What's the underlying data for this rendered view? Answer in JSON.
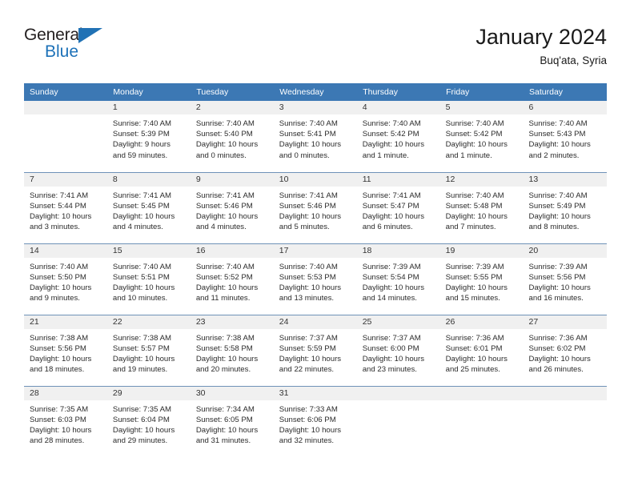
{
  "brand": {
    "name_part1": "General",
    "name_part2": "Blue",
    "accent_color": "#2172b5",
    "triangle_icon": "triangle-icon"
  },
  "header": {
    "title": "January 2024",
    "subtitle": "Buq'ata, Syria",
    "header_bg_color": "#3c78b4"
  },
  "calendar": {
    "weekday_headers": [
      "Sunday",
      "Monday",
      "Tuesday",
      "Wednesday",
      "Thursday",
      "Friday",
      "Saturday"
    ],
    "weeks": [
      [
        {
          "day": "",
          "sunrise": "",
          "sunset": "",
          "daylight_line1": "",
          "daylight_line2": ""
        },
        {
          "day": "1",
          "sunrise": "Sunrise: 7:40 AM",
          "sunset": "Sunset: 5:39 PM",
          "daylight_line1": "Daylight: 9 hours",
          "daylight_line2": "and 59 minutes."
        },
        {
          "day": "2",
          "sunrise": "Sunrise: 7:40 AM",
          "sunset": "Sunset: 5:40 PM",
          "daylight_line1": "Daylight: 10 hours",
          "daylight_line2": "and 0 minutes."
        },
        {
          "day": "3",
          "sunrise": "Sunrise: 7:40 AM",
          "sunset": "Sunset: 5:41 PM",
          "daylight_line1": "Daylight: 10 hours",
          "daylight_line2": "and 0 minutes."
        },
        {
          "day": "4",
          "sunrise": "Sunrise: 7:40 AM",
          "sunset": "Sunset: 5:42 PM",
          "daylight_line1": "Daylight: 10 hours",
          "daylight_line2": "and 1 minute."
        },
        {
          "day": "5",
          "sunrise": "Sunrise: 7:40 AM",
          "sunset": "Sunset: 5:42 PM",
          "daylight_line1": "Daylight: 10 hours",
          "daylight_line2": "and 1 minute."
        },
        {
          "day": "6",
          "sunrise": "Sunrise: 7:40 AM",
          "sunset": "Sunset: 5:43 PM",
          "daylight_line1": "Daylight: 10 hours",
          "daylight_line2": "and 2 minutes."
        }
      ],
      [
        {
          "day": "7",
          "sunrise": "Sunrise: 7:41 AM",
          "sunset": "Sunset: 5:44 PM",
          "daylight_line1": "Daylight: 10 hours",
          "daylight_line2": "and 3 minutes."
        },
        {
          "day": "8",
          "sunrise": "Sunrise: 7:41 AM",
          "sunset": "Sunset: 5:45 PM",
          "daylight_line1": "Daylight: 10 hours",
          "daylight_line2": "and 4 minutes."
        },
        {
          "day": "9",
          "sunrise": "Sunrise: 7:41 AM",
          "sunset": "Sunset: 5:46 PM",
          "daylight_line1": "Daylight: 10 hours",
          "daylight_line2": "and 4 minutes."
        },
        {
          "day": "10",
          "sunrise": "Sunrise: 7:41 AM",
          "sunset": "Sunset: 5:46 PM",
          "daylight_line1": "Daylight: 10 hours",
          "daylight_line2": "and 5 minutes."
        },
        {
          "day": "11",
          "sunrise": "Sunrise: 7:41 AM",
          "sunset": "Sunset: 5:47 PM",
          "daylight_line1": "Daylight: 10 hours",
          "daylight_line2": "and 6 minutes."
        },
        {
          "day": "12",
          "sunrise": "Sunrise: 7:40 AM",
          "sunset": "Sunset: 5:48 PM",
          "daylight_line1": "Daylight: 10 hours",
          "daylight_line2": "and 7 minutes."
        },
        {
          "day": "13",
          "sunrise": "Sunrise: 7:40 AM",
          "sunset": "Sunset: 5:49 PM",
          "daylight_line1": "Daylight: 10 hours",
          "daylight_line2": "and 8 minutes."
        }
      ],
      [
        {
          "day": "14",
          "sunrise": "Sunrise: 7:40 AM",
          "sunset": "Sunset: 5:50 PM",
          "daylight_line1": "Daylight: 10 hours",
          "daylight_line2": "and 9 minutes."
        },
        {
          "day": "15",
          "sunrise": "Sunrise: 7:40 AM",
          "sunset": "Sunset: 5:51 PM",
          "daylight_line1": "Daylight: 10 hours",
          "daylight_line2": "and 10 minutes."
        },
        {
          "day": "16",
          "sunrise": "Sunrise: 7:40 AM",
          "sunset": "Sunset: 5:52 PM",
          "daylight_line1": "Daylight: 10 hours",
          "daylight_line2": "and 11 minutes."
        },
        {
          "day": "17",
          "sunrise": "Sunrise: 7:40 AM",
          "sunset": "Sunset: 5:53 PM",
          "daylight_line1": "Daylight: 10 hours",
          "daylight_line2": "and 13 minutes."
        },
        {
          "day": "18",
          "sunrise": "Sunrise: 7:39 AM",
          "sunset": "Sunset: 5:54 PM",
          "daylight_line1": "Daylight: 10 hours",
          "daylight_line2": "and 14 minutes."
        },
        {
          "day": "19",
          "sunrise": "Sunrise: 7:39 AM",
          "sunset": "Sunset: 5:55 PM",
          "daylight_line1": "Daylight: 10 hours",
          "daylight_line2": "and 15 minutes."
        },
        {
          "day": "20",
          "sunrise": "Sunrise: 7:39 AM",
          "sunset": "Sunset: 5:56 PM",
          "daylight_line1": "Daylight: 10 hours",
          "daylight_line2": "and 16 minutes."
        }
      ],
      [
        {
          "day": "21",
          "sunrise": "Sunrise: 7:38 AM",
          "sunset": "Sunset: 5:56 PM",
          "daylight_line1": "Daylight: 10 hours",
          "daylight_line2": "and 18 minutes."
        },
        {
          "day": "22",
          "sunrise": "Sunrise: 7:38 AM",
          "sunset": "Sunset: 5:57 PM",
          "daylight_line1": "Daylight: 10 hours",
          "daylight_line2": "and 19 minutes."
        },
        {
          "day": "23",
          "sunrise": "Sunrise: 7:38 AM",
          "sunset": "Sunset: 5:58 PM",
          "daylight_line1": "Daylight: 10 hours",
          "daylight_line2": "and 20 minutes."
        },
        {
          "day": "24",
          "sunrise": "Sunrise: 7:37 AM",
          "sunset": "Sunset: 5:59 PM",
          "daylight_line1": "Daylight: 10 hours",
          "daylight_line2": "and 22 minutes."
        },
        {
          "day": "25",
          "sunrise": "Sunrise: 7:37 AM",
          "sunset": "Sunset: 6:00 PM",
          "daylight_line1": "Daylight: 10 hours",
          "daylight_line2": "and 23 minutes."
        },
        {
          "day": "26",
          "sunrise": "Sunrise: 7:36 AM",
          "sunset": "Sunset: 6:01 PM",
          "daylight_line1": "Daylight: 10 hours",
          "daylight_line2": "and 25 minutes."
        },
        {
          "day": "27",
          "sunrise": "Sunrise: 7:36 AM",
          "sunset": "Sunset: 6:02 PM",
          "daylight_line1": "Daylight: 10 hours",
          "daylight_line2": "and 26 minutes."
        }
      ],
      [
        {
          "day": "28",
          "sunrise": "Sunrise: 7:35 AM",
          "sunset": "Sunset: 6:03 PM",
          "daylight_line1": "Daylight: 10 hours",
          "daylight_line2": "and 28 minutes."
        },
        {
          "day": "29",
          "sunrise": "Sunrise: 7:35 AM",
          "sunset": "Sunset: 6:04 PM",
          "daylight_line1": "Daylight: 10 hours",
          "daylight_line2": "and 29 minutes."
        },
        {
          "day": "30",
          "sunrise": "Sunrise: 7:34 AM",
          "sunset": "Sunset: 6:05 PM",
          "daylight_line1": "Daylight: 10 hours",
          "daylight_line2": "and 31 minutes."
        },
        {
          "day": "31",
          "sunrise": "Sunrise: 7:33 AM",
          "sunset": "Sunset: 6:06 PM",
          "daylight_line1": "Daylight: 10 hours",
          "daylight_line2": "and 32 minutes."
        },
        {
          "day": "",
          "sunrise": "",
          "sunset": "",
          "daylight_line1": "",
          "daylight_line2": ""
        },
        {
          "day": "",
          "sunrise": "",
          "sunset": "",
          "daylight_line1": "",
          "daylight_line2": ""
        },
        {
          "day": "",
          "sunrise": "",
          "sunset": "",
          "daylight_line1": "",
          "daylight_line2": ""
        }
      ]
    ]
  }
}
